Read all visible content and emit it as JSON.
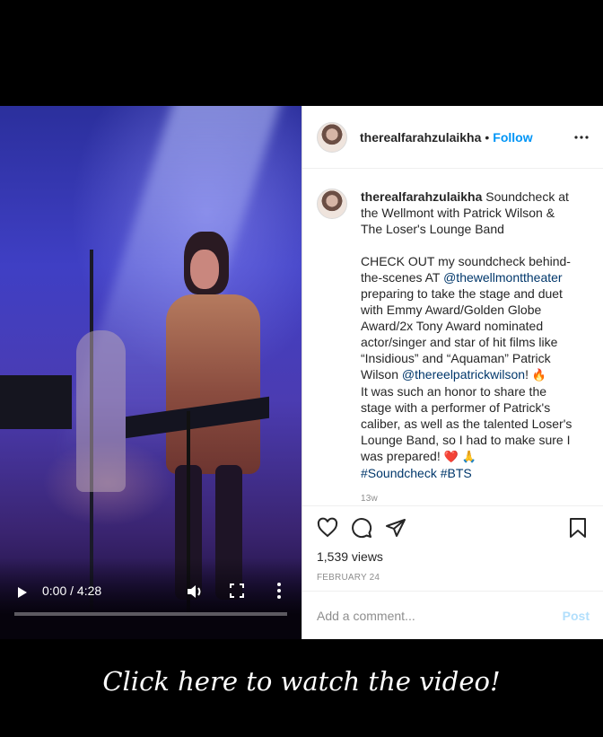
{
  "video": {
    "time": "0:00 / 4:28",
    "progress": 0.0,
    "icons": [
      "play-icon",
      "volume-icon",
      "fullscreen-icon",
      "more-vertical-icon"
    ]
  },
  "post": {
    "username": "therealfarahzulaikha",
    "separator": "•",
    "follow_label": "Follow",
    "caption_intro": "Soundcheck at the Wellmont with Patrick Wilson & The Loser's Lounge Band",
    "caption_p1": "CHECK OUT my soundcheck behind-the-scenes AT ",
    "mention_theater": "@thewellmonttheater",
    "caption_p2": " preparing to take the stage and duet with Emmy Award/Golden Globe Award/2x Tony Award nominated actor/singer and star of hit films like “Insidious” and “Aquaman” Patrick Wilson ",
    "mention_patrick": "@thereelpatrickwilson",
    "caption_p3": "! ",
    "emoji_fire": "🔥",
    "caption_p4": "It was such an honor to share the stage with a performer of Patrick's caliber, as well as the talented Loser's Lounge Band, so I had to make sure I was prepared! ",
    "emoji_heart": "❤️",
    "emoji_pray": "🙏",
    "hashtag_soundcheck": "#Soundcheck",
    "hashtag_bts": "#BTS",
    "caption_age": "13w",
    "views": "1,539 views",
    "date": "FEBRUARY 24",
    "comment_placeholder": "Add a comment...",
    "post_label": "Post"
  },
  "cta": "Click here to watch the video!",
  "colors": {
    "link": "#0095f6",
    "mention": "#00376b",
    "post_disabled": "#b2dffc",
    "muted": "#8e8e8e"
  }
}
